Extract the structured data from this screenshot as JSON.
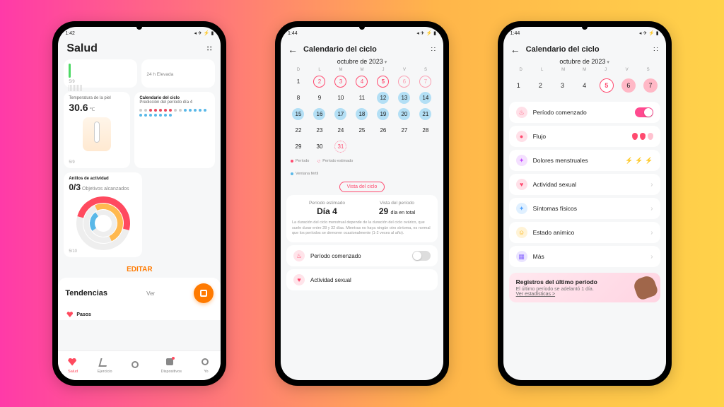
{
  "status": {
    "time1": "1:42",
    "time2": "1:44",
    "time3": "1:44"
  },
  "p1": {
    "title": "Salud",
    "card_bar_foot": "5/9",
    "card_b_text": "24 h Elevada",
    "temp": {
      "label": "Temperatura de la piel",
      "value": "30.6",
      "unit": "℃",
      "foot": "5/9"
    },
    "cycle": {
      "label": "Calendario del ciclo",
      "sub": "Predicción del período día 4"
    },
    "rings": {
      "label": "Anillos de actividad",
      "value": "0/3",
      "sub": "Objetivos alcanzados",
      "foot": "5/10"
    },
    "edit": "EDITAR",
    "trends": "Tendencias",
    "trends_more": "Ver",
    "nav_pasos": "Pasos",
    "nav": [
      "Salud",
      "Ejercicio",
      "Dispositivos",
      "Yo"
    ]
  },
  "p2": {
    "title": "Calendario del ciclo",
    "month": "octubre de 2023",
    "wdays": [
      "D",
      "L",
      "M",
      "M",
      "J",
      "V",
      "S"
    ],
    "days": [
      1,
      2,
      3,
      4,
      5,
      6,
      7,
      8,
      9,
      10,
      11,
      12,
      13,
      14,
      15,
      16,
      17,
      18,
      19,
      20,
      21,
      22,
      23,
      24,
      25,
      26,
      27,
      28,
      29,
      30,
      31
    ],
    "legend": {
      "a": "Período",
      "b": "Período estimado",
      "c": "Ventana fértil"
    },
    "vista": "Vista del ciclo",
    "est_label": "Período estimado",
    "est_val": "Día 4",
    "len_label": "Vista del período",
    "len_val": "29",
    "len_unit": "día en total",
    "info": "La duración del ciclo menstrual depende de la duración del ciclo ovárico, que suele durar entre 28 y 32 días. Mientras no haya ningún otro síntoma, es normal que los períodos se demoren ocasionalmente (1-2 veces al año).",
    "log1": "Período comenzado",
    "log2": "Actividad sexual"
  },
  "p3": {
    "title": "Calendario del ciclo",
    "month": "octubre de 2023",
    "wdays": [
      "D",
      "L",
      "M",
      "M",
      "J",
      "V",
      "S"
    ],
    "days": [
      1,
      2,
      3,
      4,
      5,
      6,
      7
    ],
    "rows": {
      "r1": "Período comenzado",
      "r2": "Flujo",
      "r3": "Dolores menstruales",
      "r4": "Actividad sexual",
      "r5": "Síntomas físicos",
      "r6": "Estado anímico",
      "r7": "Más"
    },
    "reg_title": "Registros del último período",
    "reg_sub": "El último período se adelantó 1 día.",
    "reg_link": "Ver estadísticas >"
  }
}
